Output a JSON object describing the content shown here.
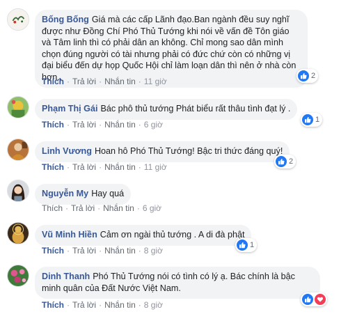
{
  "comments": [
    {
      "author": "Bống Bống",
      "text": "Giá mà các cấp Lãnh đạo.Ban ngành đều suy nghĩ được như Đồng Chí Phó Thủ Tướng khi nói về vấn đề Tôn giáo và Tâm linh thì có phải dân an không. Chỉ mong sao dân mình chọn đúng người có tài nhưng phải có đức chứ còn có những vị đại biểu đến dự họp Quốc Hội chỉ làm loạn dân thì nên ở nhà còn hơn..",
      "reaction_count": "2",
      "like_label": "Thích",
      "reply_label": "Trả lời",
      "message_label": "Nhắn tin",
      "time": "11 giờ"
    },
    {
      "author": "Phạm Thị Gái",
      "text": "Bác phô thủ tướng Phát biểu rất thâu tình đạt lý .",
      "reaction_count": "1",
      "like_label": "Thích",
      "reply_label": "Trả lời",
      "message_label": "Nhắn tin",
      "time": "6 giờ"
    },
    {
      "author": "Linh Vương",
      "text": "Hoan hô Phó Thủ Tướng! Bậc tri thức đáng quý!",
      "reaction_count": "2",
      "like_label": "Thích",
      "reply_label": "Trả lời",
      "message_label": "Nhắn tin",
      "time": "11 giờ"
    },
    {
      "author": "Nguyễn My",
      "text": "Hay quá",
      "reaction_count": "",
      "like_label": "Thích",
      "reply_label": "Trả lời",
      "message_label": "Nhắn tin",
      "time": "6 giờ"
    },
    {
      "author": "Vũ Minh Hiền",
      "text": "Cảm ơn ngài thủ tướng . A di đà phật",
      "reaction_count": "1",
      "like_label": "Thích",
      "reply_label": "Trả lời",
      "message_label": "Nhắn tin",
      "time": "8 giờ"
    },
    {
      "author": "Dinh Thanh",
      "text": "Phó Thủ Tướng nói có tình có lý ạ. Bác chính là bậc minh quân của Đất Nước Việt Nam.",
      "reaction_count": "",
      "like_label": "Thích",
      "reply_label": "Trả lời",
      "message_label": "Nhắn tin",
      "time": "8 giờ"
    }
  ],
  "colors": {
    "author_link": "#385898",
    "bubble_bg": "#f2f3f5",
    "like_blue": "#2078f4",
    "meta_gray": "#90949c"
  }
}
